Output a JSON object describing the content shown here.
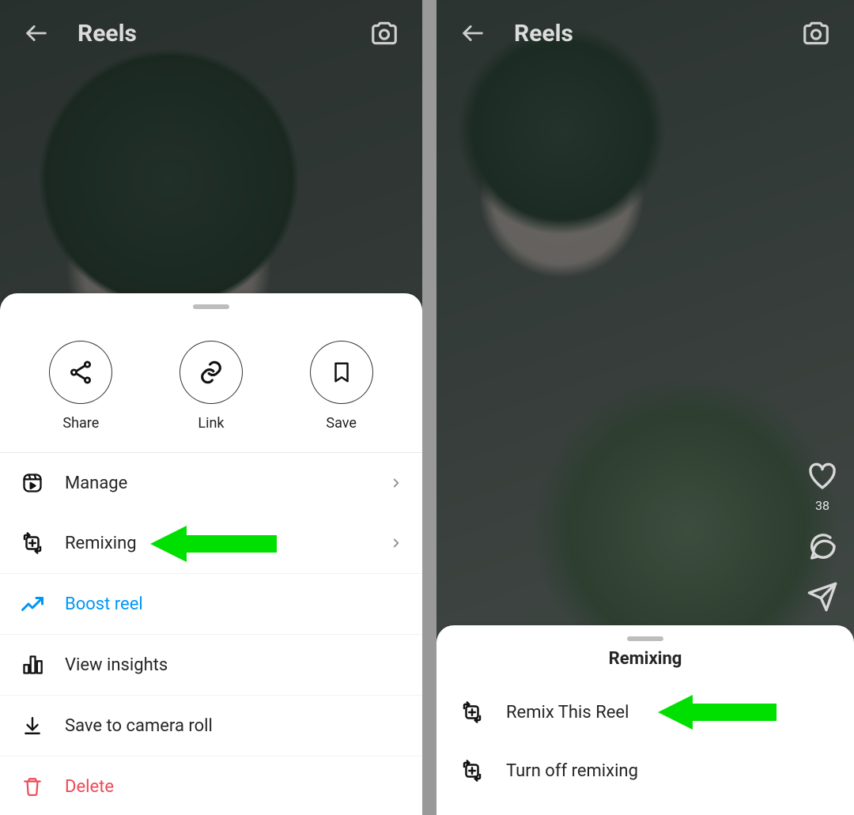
{
  "left": {
    "topbar": {
      "title": "Reels"
    },
    "actions": {
      "share": "Share",
      "link": "Link",
      "save": "Save"
    },
    "menu": {
      "manage": "Manage",
      "remixing": "Remixing",
      "boost": "Boost reel",
      "insights": "View insights",
      "save_camera": "Save to camera roll",
      "delete": "Delete"
    }
  },
  "right": {
    "topbar": {
      "title": "Reels"
    },
    "likes": "38",
    "sheet": {
      "title": "Remixing",
      "remix_this": "Remix This Reel",
      "turn_off": "Turn off remixing"
    }
  },
  "colors": {
    "accent_blue": "#0095f6",
    "danger_red": "#ed4956",
    "annotation_green": "#00e000"
  }
}
